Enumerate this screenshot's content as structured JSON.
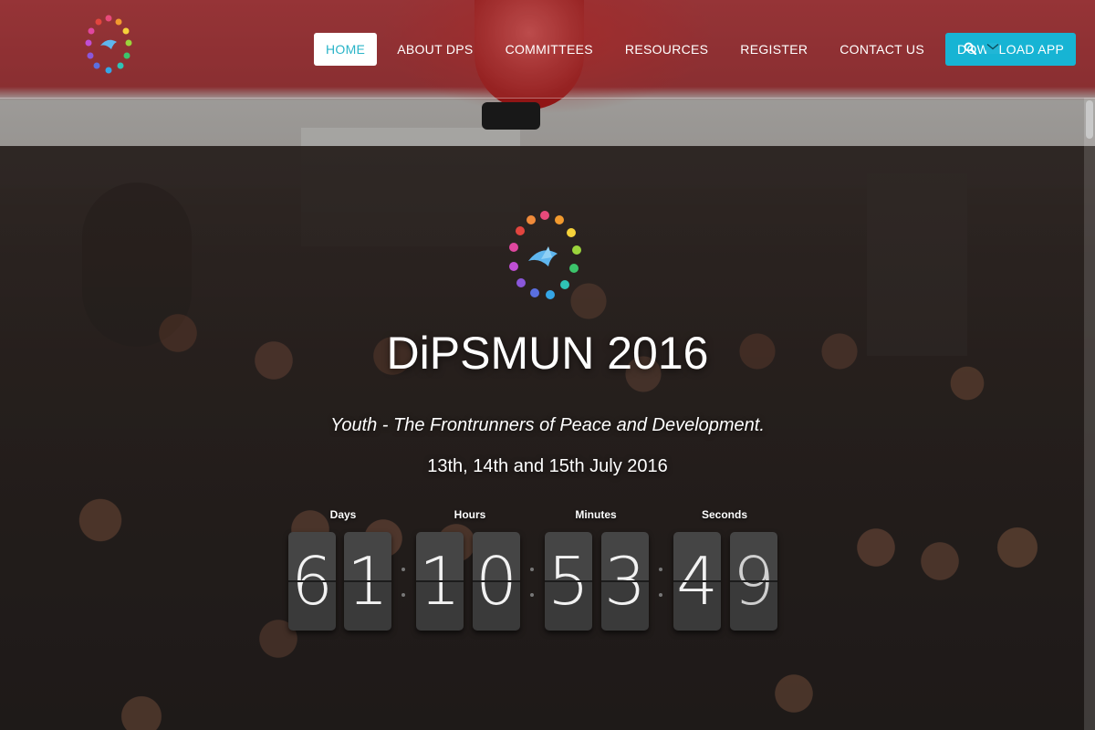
{
  "colors": {
    "accent": "#17b4d4",
    "active_text": "#2ab4c8",
    "nav_text": "#ffffff",
    "digit_bg": "#3a3a3a"
  },
  "nav": {
    "items": [
      {
        "label": "HOME",
        "active": true
      },
      {
        "label": "ABOUT DPS"
      },
      {
        "label": "COMMITTEES"
      },
      {
        "label": "RESOURCES"
      },
      {
        "label": "REGISTER"
      },
      {
        "label": "CONTACT US"
      },
      {
        "label": "DOWNLOAD APP"
      }
    ],
    "icons": [
      "search-icon",
      "mail-icon"
    ]
  },
  "hero": {
    "title": "DiPSMUN 2016",
    "tagline": "Youth - The Frontrunners of Peace and Development.",
    "dates": "13th, 14th and 15th July 2016"
  },
  "countdown": {
    "labels": {
      "days": "Days",
      "hours": "Hours",
      "minutes": "Minutes",
      "seconds": "Seconds"
    },
    "days": [
      "6",
      "1"
    ],
    "hours": [
      "1",
      "0"
    ],
    "minutes": [
      "5",
      "3"
    ],
    "seconds": [
      "4",
      "9"
    ]
  }
}
